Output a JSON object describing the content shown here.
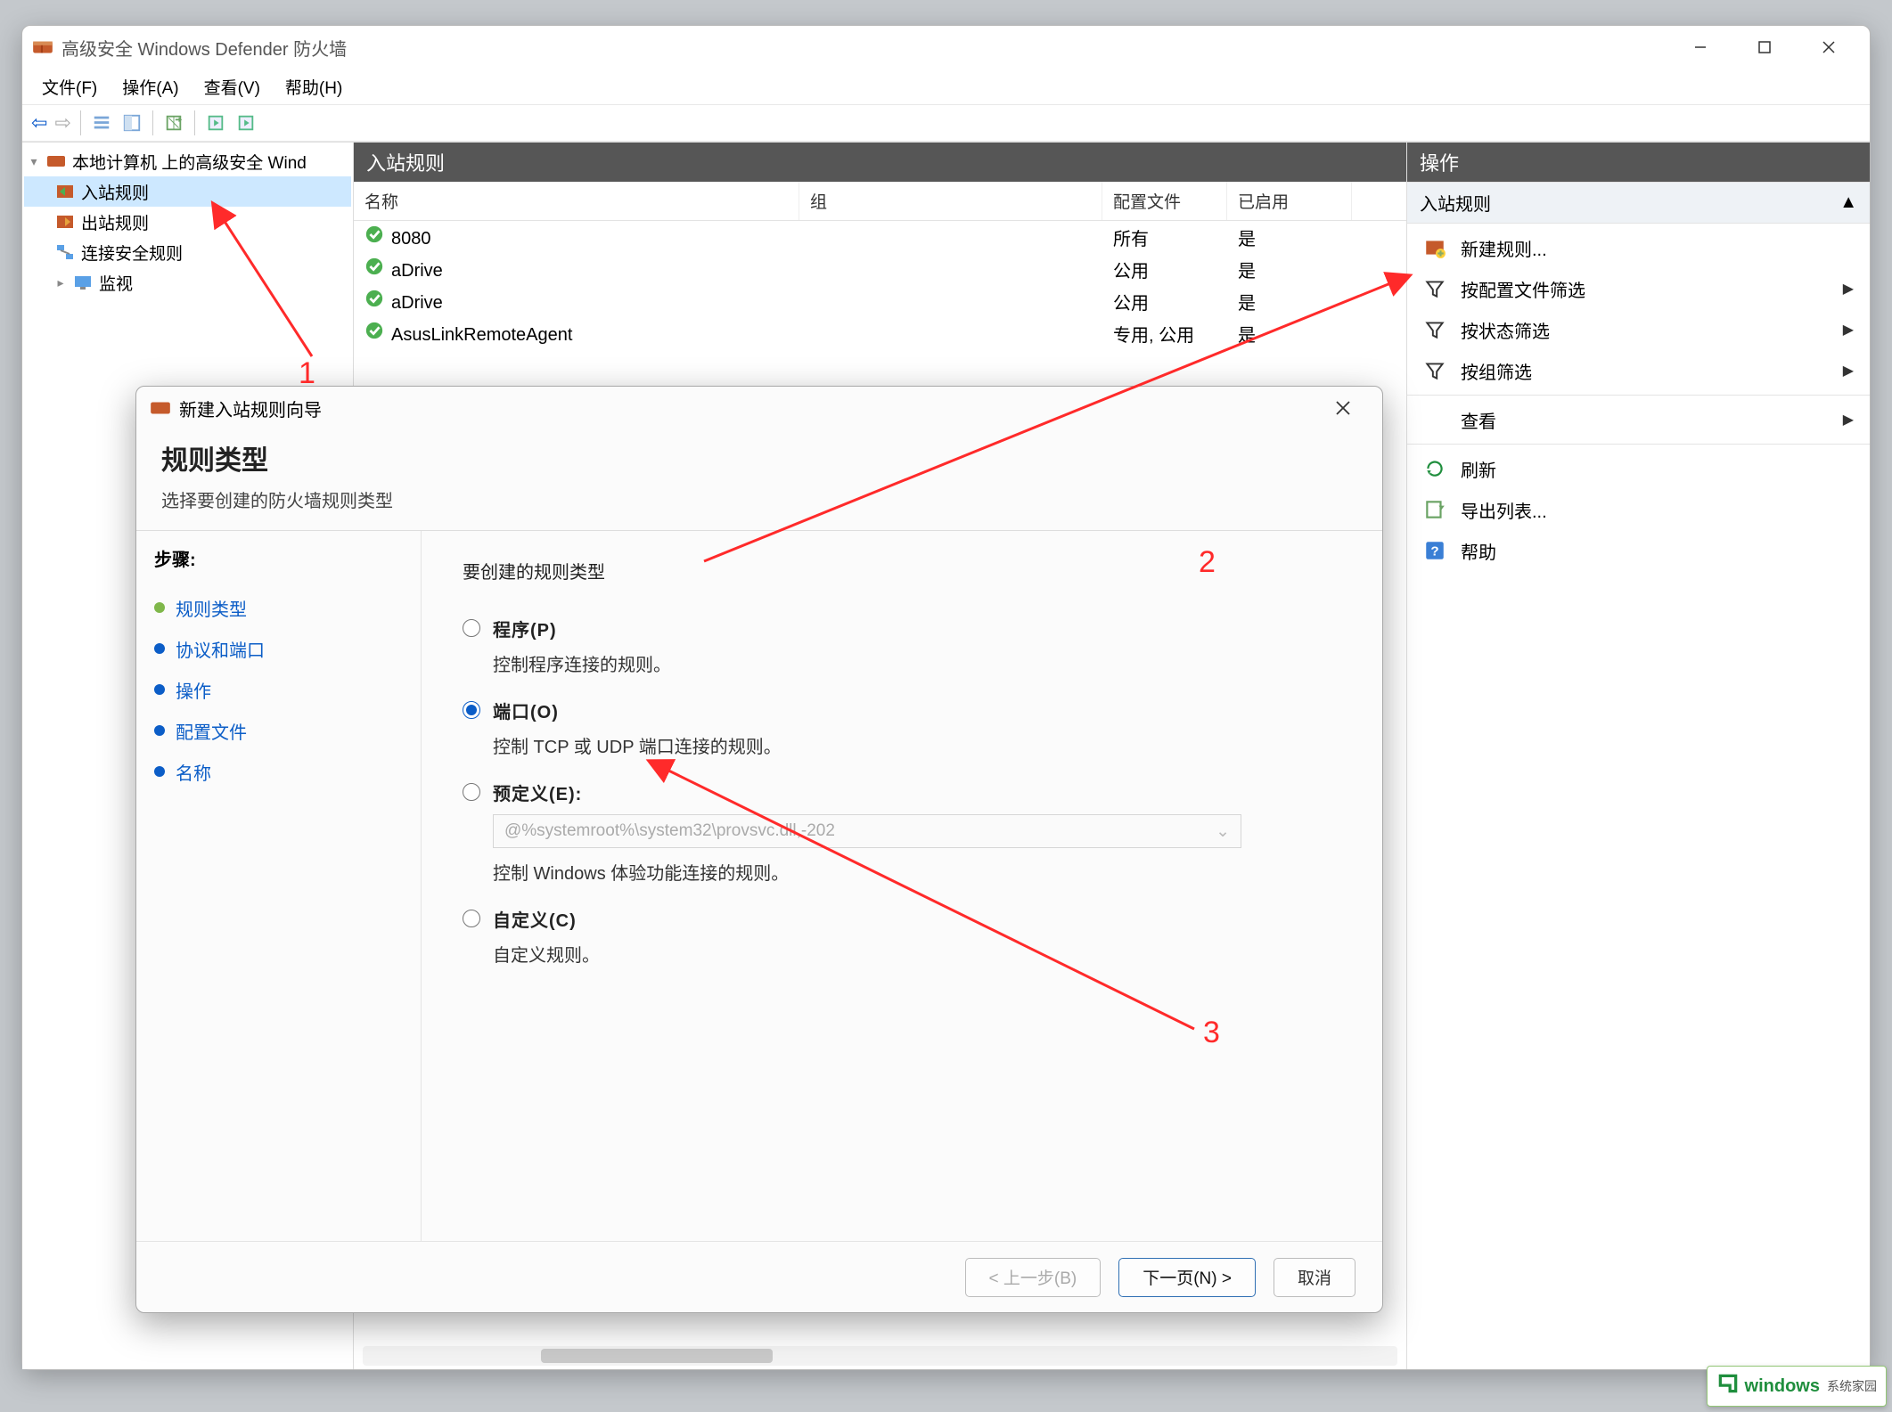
{
  "window": {
    "title": "高级安全 Windows Defender 防火墙"
  },
  "menubar": [
    "文件(F)",
    "操作(A)",
    "查看(V)",
    "帮助(H)"
  ],
  "tree": {
    "root": "本地计算机 上的高级安全 Wind",
    "items": [
      "入站规则",
      "出站规则",
      "连接安全规则",
      "监视"
    ]
  },
  "center": {
    "header": "入站规则",
    "columns": {
      "name": "名称",
      "group": "组",
      "profile": "配置文件",
      "enabled": "已启用"
    },
    "rows": [
      {
        "name": "8080",
        "group": "",
        "profile": "所有",
        "enabled": "是"
      },
      {
        "name": "aDrive",
        "group": "",
        "profile": "公用",
        "enabled": "是"
      },
      {
        "name": "aDrive",
        "group": "",
        "profile": "公用",
        "enabled": "是"
      },
      {
        "name": "AsusLinkRemoteAgent",
        "group": "",
        "profile": "专用, 公用",
        "enabled": "是"
      }
    ]
  },
  "actions": {
    "header": "操作",
    "group_title": "入站规则",
    "items": [
      {
        "icon": "new",
        "label": "新建规则...",
        "chev": false
      },
      {
        "icon": "funnel",
        "label": "按配置文件筛选",
        "chev": true
      },
      {
        "icon": "funnel",
        "label": "按状态筛选",
        "chev": true
      },
      {
        "icon": "funnel",
        "label": "按组筛选",
        "chev": true
      },
      {
        "icon": "none",
        "label": "查看",
        "chev": true
      },
      {
        "icon": "refresh",
        "label": "刷新",
        "chev": false
      },
      {
        "icon": "export",
        "label": "导出列表...",
        "chev": false
      },
      {
        "icon": "help",
        "label": "帮助",
        "chev": false
      }
    ]
  },
  "wizard": {
    "title": "新建入站规则向导",
    "header": "规则类型",
    "sub": "选择要创建的防火墙规则类型",
    "steps_label": "步骤:",
    "steps": [
      "规则类型",
      "协议和端口",
      "操作",
      "配置文件",
      "名称"
    ],
    "active_step_index": 1,
    "question": "要创建的规则类型",
    "options": {
      "program": {
        "label": "程序(P)",
        "desc": "控制程序连接的规则。"
      },
      "port": {
        "label": "端口(O)",
        "desc": "控制 TCP 或 UDP 端口连接的规则。"
      },
      "predefined": {
        "label": "预定义(E):",
        "select_placeholder": "@%systemroot%\\system32\\provsvc.dll,-202",
        "desc": "控制 Windows 体验功能连接的规则。"
      },
      "custom": {
        "label": "自定义(C)",
        "desc": "自定义规则。"
      }
    },
    "selected": "port",
    "buttons": {
      "back": "< 上一步(B)",
      "next": "下一页(N) >",
      "cancel": "取消"
    }
  },
  "annotations": {
    "n1": "1",
    "n2": "2",
    "n3": "3"
  },
  "watermark": {
    "brand": "windows",
    "sub": "系统家园"
  }
}
